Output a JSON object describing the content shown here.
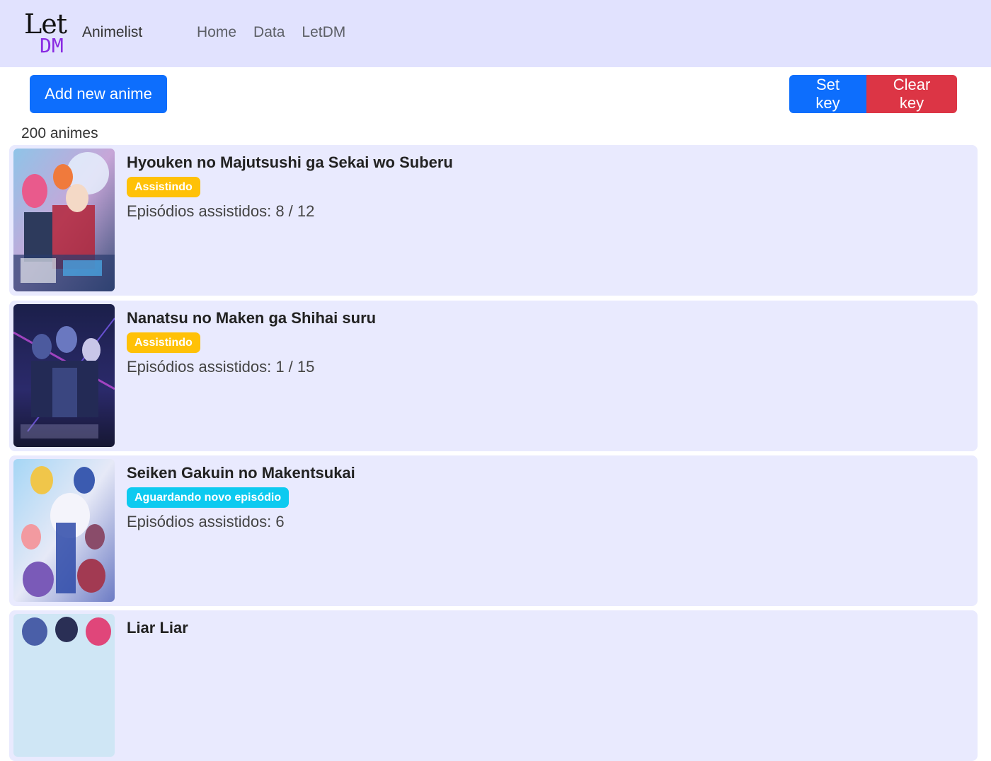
{
  "brand": {
    "logo_top": "Let",
    "logo_bottom": "DM",
    "name": "Animelist"
  },
  "nav": {
    "links": [
      "Home",
      "Data",
      "LetDM"
    ]
  },
  "toolbar": {
    "add_label": "Add new anime",
    "set_key_label": "Set key",
    "clear_key_label": "Clear key"
  },
  "count_text": "200 animes",
  "colors": {
    "navbar_bg": "#e1e2fe",
    "card_bg": "#e9eafe",
    "primary": "#0d6efd",
    "danger": "#dc3545",
    "badge_watching": "#ffc107",
    "badge_waiting": "#0dcaf0",
    "logo_accent": "#8a2be2"
  },
  "animes": [
    {
      "title": "Hyouken no Majutsushi ga Sekai wo Suberu",
      "status": "Assistindo",
      "episodes": "Episódios assistidos: 8 / 12"
    },
    {
      "title": "Nanatsu no Maken ga Shihai suru",
      "status": "Assistindo",
      "episodes": "Episódios assistidos: 1 / 15"
    },
    {
      "title": "Seiken Gakuin no Makentsukai",
      "status": "Aguardando novo episódio",
      "episodes": "Episódios assistidos: 6"
    },
    {
      "title": "Liar Liar",
      "status": "",
      "episodes": ""
    }
  ]
}
